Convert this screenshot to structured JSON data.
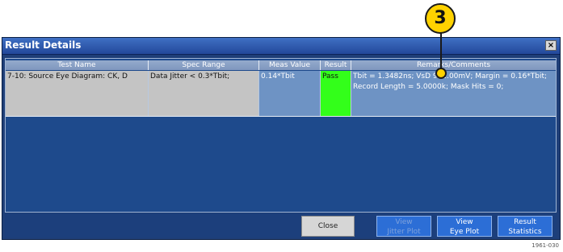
{
  "window": {
    "title": "Result Details",
    "close_glyph": "×"
  },
  "table": {
    "columns": [
      "Test Name",
      "Spec Range",
      "Meas Value",
      "Result",
      "Remarks/Comments"
    ],
    "rows": [
      {
        "test_name": "7-10: Source Eye Diagram: CK, D",
        "spec_range": "Data Jitter < 0.3*Tbit;",
        "meas_value": "0.14*Tbit",
        "result": "Pass",
        "remarks": "Tbit = 1.3482ns; VsD 952.00mV; Margin = 0.16*Tbit; Record Length = 5.0000k; Mask Hits = 0;"
      }
    ]
  },
  "buttons": {
    "close": "Close",
    "view_jitter_line1": "View",
    "view_jitter_line2": "Jitter Plot",
    "view_eye_line1": "View",
    "view_eye_line2": "Eye Plot",
    "result_stats_line1": "Result",
    "result_stats_line2": "Statistics"
  },
  "callout": {
    "number": "3"
  },
  "figure_id": "1961-030",
  "colors": {
    "pass": "#33ff1a",
    "header": "#8ca3c8",
    "window": "#1f3f78"
  }
}
